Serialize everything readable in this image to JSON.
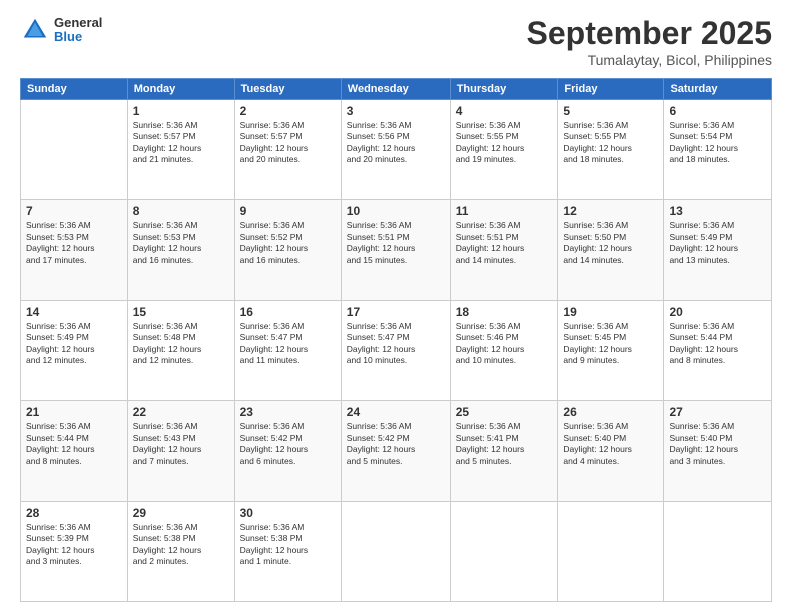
{
  "header": {
    "logo_general": "General",
    "logo_blue": "Blue",
    "month_title": "September 2025",
    "location": "Tumalaytay, Bicol, Philippines"
  },
  "days_of_week": [
    "Sunday",
    "Monday",
    "Tuesday",
    "Wednesday",
    "Thursday",
    "Friday",
    "Saturday"
  ],
  "weeks": [
    [
      {
        "day": "",
        "info": ""
      },
      {
        "day": "1",
        "info": "Sunrise: 5:36 AM\nSunset: 5:57 PM\nDaylight: 12 hours\nand 21 minutes."
      },
      {
        "day": "2",
        "info": "Sunrise: 5:36 AM\nSunset: 5:57 PM\nDaylight: 12 hours\nand 20 minutes."
      },
      {
        "day": "3",
        "info": "Sunrise: 5:36 AM\nSunset: 5:56 PM\nDaylight: 12 hours\nand 20 minutes."
      },
      {
        "day": "4",
        "info": "Sunrise: 5:36 AM\nSunset: 5:55 PM\nDaylight: 12 hours\nand 19 minutes."
      },
      {
        "day": "5",
        "info": "Sunrise: 5:36 AM\nSunset: 5:55 PM\nDaylight: 12 hours\nand 18 minutes."
      },
      {
        "day": "6",
        "info": "Sunrise: 5:36 AM\nSunset: 5:54 PM\nDaylight: 12 hours\nand 18 minutes."
      }
    ],
    [
      {
        "day": "7",
        "info": "Sunrise: 5:36 AM\nSunset: 5:53 PM\nDaylight: 12 hours\nand 17 minutes."
      },
      {
        "day": "8",
        "info": "Sunrise: 5:36 AM\nSunset: 5:53 PM\nDaylight: 12 hours\nand 16 minutes."
      },
      {
        "day": "9",
        "info": "Sunrise: 5:36 AM\nSunset: 5:52 PM\nDaylight: 12 hours\nand 16 minutes."
      },
      {
        "day": "10",
        "info": "Sunrise: 5:36 AM\nSunset: 5:51 PM\nDaylight: 12 hours\nand 15 minutes."
      },
      {
        "day": "11",
        "info": "Sunrise: 5:36 AM\nSunset: 5:51 PM\nDaylight: 12 hours\nand 14 minutes."
      },
      {
        "day": "12",
        "info": "Sunrise: 5:36 AM\nSunset: 5:50 PM\nDaylight: 12 hours\nand 14 minutes."
      },
      {
        "day": "13",
        "info": "Sunrise: 5:36 AM\nSunset: 5:49 PM\nDaylight: 12 hours\nand 13 minutes."
      }
    ],
    [
      {
        "day": "14",
        "info": "Sunrise: 5:36 AM\nSunset: 5:49 PM\nDaylight: 12 hours\nand 12 minutes."
      },
      {
        "day": "15",
        "info": "Sunrise: 5:36 AM\nSunset: 5:48 PM\nDaylight: 12 hours\nand 12 minutes."
      },
      {
        "day": "16",
        "info": "Sunrise: 5:36 AM\nSunset: 5:47 PM\nDaylight: 12 hours\nand 11 minutes."
      },
      {
        "day": "17",
        "info": "Sunrise: 5:36 AM\nSunset: 5:47 PM\nDaylight: 12 hours\nand 10 minutes."
      },
      {
        "day": "18",
        "info": "Sunrise: 5:36 AM\nSunset: 5:46 PM\nDaylight: 12 hours\nand 10 minutes."
      },
      {
        "day": "19",
        "info": "Sunrise: 5:36 AM\nSunset: 5:45 PM\nDaylight: 12 hours\nand 9 minutes."
      },
      {
        "day": "20",
        "info": "Sunrise: 5:36 AM\nSunset: 5:44 PM\nDaylight: 12 hours\nand 8 minutes."
      }
    ],
    [
      {
        "day": "21",
        "info": "Sunrise: 5:36 AM\nSunset: 5:44 PM\nDaylight: 12 hours\nand 8 minutes."
      },
      {
        "day": "22",
        "info": "Sunrise: 5:36 AM\nSunset: 5:43 PM\nDaylight: 12 hours\nand 7 minutes."
      },
      {
        "day": "23",
        "info": "Sunrise: 5:36 AM\nSunset: 5:42 PM\nDaylight: 12 hours\nand 6 minutes."
      },
      {
        "day": "24",
        "info": "Sunrise: 5:36 AM\nSunset: 5:42 PM\nDaylight: 12 hours\nand 5 minutes."
      },
      {
        "day": "25",
        "info": "Sunrise: 5:36 AM\nSunset: 5:41 PM\nDaylight: 12 hours\nand 5 minutes."
      },
      {
        "day": "26",
        "info": "Sunrise: 5:36 AM\nSunset: 5:40 PM\nDaylight: 12 hours\nand 4 minutes."
      },
      {
        "day": "27",
        "info": "Sunrise: 5:36 AM\nSunset: 5:40 PM\nDaylight: 12 hours\nand 3 minutes."
      }
    ],
    [
      {
        "day": "28",
        "info": "Sunrise: 5:36 AM\nSunset: 5:39 PM\nDaylight: 12 hours\nand 3 minutes."
      },
      {
        "day": "29",
        "info": "Sunrise: 5:36 AM\nSunset: 5:38 PM\nDaylight: 12 hours\nand 2 minutes."
      },
      {
        "day": "30",
        "info": "Sunrise: 5:36 AM\nSunset: 5:38 PM\nDaylight: 12 hours\nand 1 minute."
      },
      {
        "day": "",
        "info": ""
      },
      {
        "day": "",
        "info": ""
      },
      {
        "day": "",
        "info": ""
      },
      {
        "day": "",
        "info": ""
      }
    ]
  ]
}
